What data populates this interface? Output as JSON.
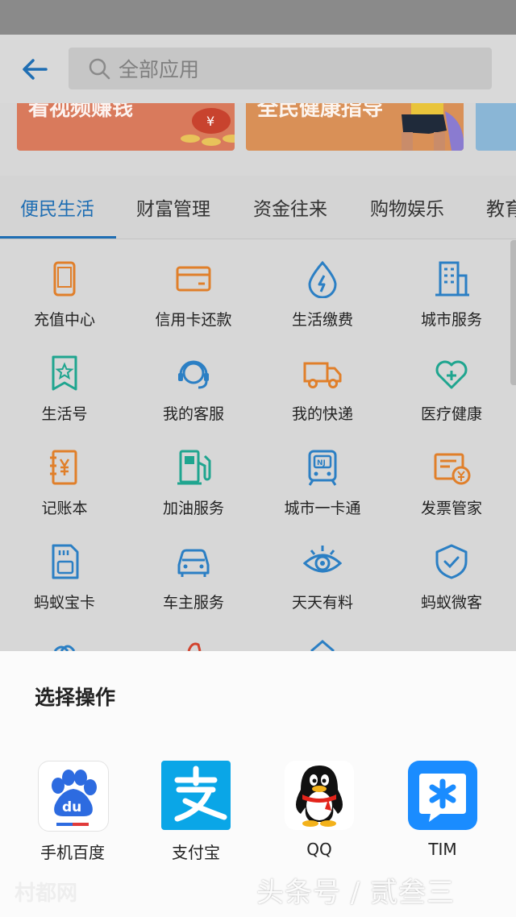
{
  "header": {
    "search_placeholder": "全部应用"
  },
  "banners": [
    {
      "text": "看视频赚钱",
      "color": "#d97a5c"
    },
    {
      "text": "全民健康指导",
      "color": "#d99057"
    },
    {
      "text": "",
      "color": "#8ab6d6"
    }
  ],
  "tabs": [
    "便民生活",
    "财富管理",
    "资金往来",
    "购物娱乐",
    "教育"
  ],
  "grid": {
    "items": [
      {
        "label": "充值中心",
        "icon": "phone-icon",
        "color": "#e07f2a"
      },
      {
        "label": "信用卡还款",
        "icon": "credit-card-icon",
        "color": "#e07f2a"
      },
      {
        "label": "生活缴费",
        "icon": "utility-drop-icon",
        "color": "#2b7fc4"
      },
      {
        "label": "城市服务",
        "icon": "city-building-icon",
        "color": "#2b7fc4"
      },
      {
        "label": "生活号",
        "icon": "bookmark-star-icon",
        "color": "#1fa58f"
      },
      {
        "label": "我的客服",
        "icon": "headset-icon",
        "color": "#2b7fc4"
      },
      {
        "label": "我的快递",
        "icon": "truck-icon",
        "color": "#e07f2a"
      },
      {
        "label": "医疗健康",
        "icon": "medical-heart-icon",
        "color": "#1fa58f"
      },
      {
        "label": "记账本",
        "icon": "ledger-yuan-icon",
        "color": "#e07f2a"
      },
      {
        "label": "加油服务",
        "icon": "fuel-pump-icon",
        "color": "#1fa58f"
      },
      {
        "label": "城市一卡通",
        "icon": "transit-card-icon",
        "color": "#2b7fc4"
      },
      {
        "label": "发票管家",
        "icon": "invoice-icon",
        "color": "#e07f2a"
      },
      {
        "label": "蚂蚁宝卡",
        "icon": "sim-card-icon",
        "color": "#2b7fc4"
      },
      {
        "label": "车主服务",
        "icon": "car-icon",
        "color": "#2b7fc4"
      },
      {
        "label": "天天有料",
        "icon": "eye-icon",
        "color": "#2b7fc4"
      },
      {
        "label": "蚂蚁微客",
        "icon": "shield-check-icon",
        "color": "#2b7fc4"
      }
    ]
  },
  "sheet": {
    "title": "选择操作",
    "apps": [
      {
        "name": "手机百度",
        "icon": "baidu-paw-icon"
      },
      {
        "name": "支付宝",
        "icon": "alipay-icon"
      },
      {
        "name": "QQ",
        "icon": "qq-penguin-icon"
      },
      {
        "name": "TIM",
        "icon": "tim-icon"
      }
    ]
  },
  "watermark": "头条号 / 贰叁三",
  "watermark_left": "村都网",
  "colors": {
    "accent": "#1f6eb3",
    "orange": "#e07f2a",
    "teal": "#1fa58f",
    "blue": "#2b7fc4"
  }
}
